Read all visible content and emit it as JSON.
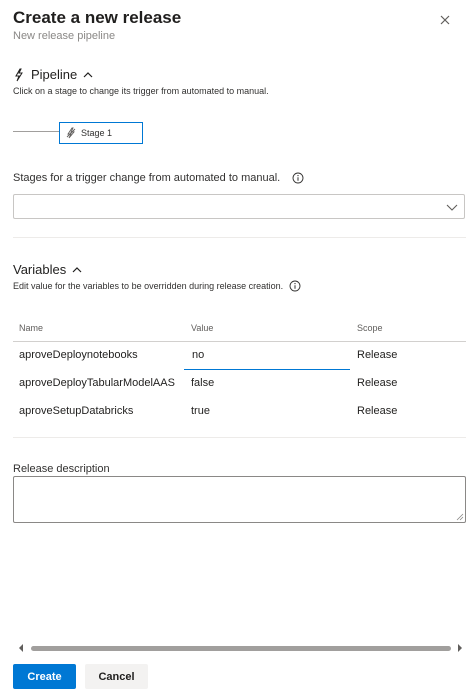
{
  "dialog": {
    "title": "Create a new release",
    "subtitle": "New release pipeline",
    "close_icon": "close-icon"
  },
  "pipeline": {
    "heading": "Pipeline",
    "description": "Click on a stage to change its trigger from automated to manual.",
    "stage_label": "Stage 1",
    "stage_icon": "lightning-manual-icon",
    "trigger_label": "Stages for a trigger change from automated to manual.",
    "trigger_value": ""
  },
  "variables": {
    "heading": "Variables",
    "description": "Edit value for the variables to be overridden during release creation.",
    "columns": {
      "name": "Name",
      "value": "Value",
      "scope": "Scope"
    },
    "rows": [
      {
        "name": "aproveDeploynotebooks",
        "value": "no",
        "scope": "Release"
      },
      {
        "name": "aproveDeployTabularModelAAS",
        "value": "false",
        "scope": "Release"
      },
      {
        "name": "aproveSetupDatabricks",
        "value": "true",
        "scope": "Release"
      }
    ]
  },
  "release_description": {
    "label": "Release description",
    "value": ""
  },
  "footer": {
    "create_label": "Create",
    "cancel_label": "Cancel"
  },
  "colors": {
    "primary": "#0078d4",
    "selected_stage_border": "#0078d4"
  }
}
